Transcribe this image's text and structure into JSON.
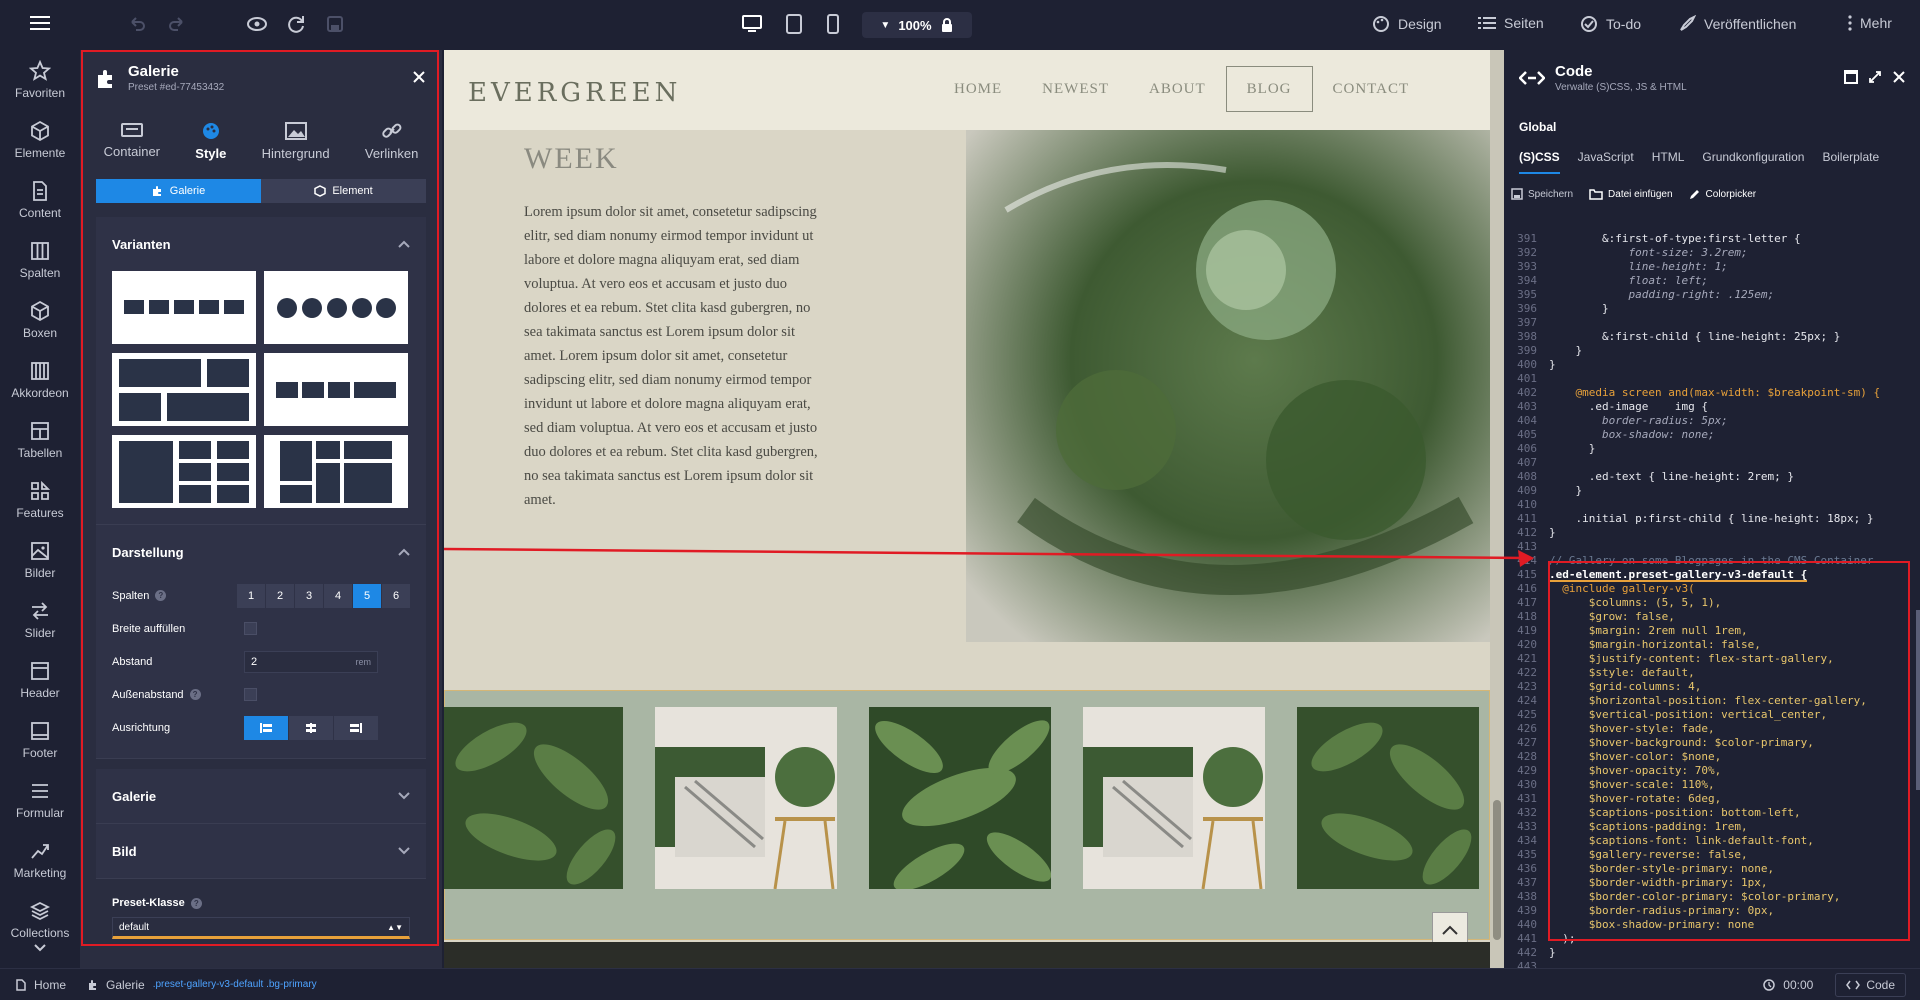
{
  "topbar": {
    "zoom": "100%",
    "design": "Design",
    "seiten": "Seiten",
    "todo": "To-do",
    "publish": "Veröffentlichen",
    "more": "Mehr"
  },
  "rail": [
    {
      "label": "Favoriten",
      "icon": "star-icon"
    },
    {
      "label": "Elemente",
      "icon": "cube-icon"
    },
    {
      "label": "Content",
      "icon": "document-icon"
    },
    {
      "label": "Spalten",
      "icon": "columns-icon"
    },
    {
      "label": "Boxen",
      "icon": "box-icon"
    },
    {
      "label": "Akkordeon",
      "icon": "accordion-icon"
    },
    {
      "label": "Tabellen",
      "icon": "table-icon"
    },
    {
      "label": "Features",
      "icon": "features-icon"
    },
    {
      "label": "Bilder",
      "icon": "image-icon"
    },
    {
      "label": "Slider",
      "icon": "slider-icon"
    },
    {
      "label": "Header",
      "icon": "header-icon"
    },
    {
      "label": "Footer",
      "icon": "footer-icon"
    },
    {
      "label": "Formular",
      "icon": "form-icon"
    },
    {
      "label": "Marketing",
      "icon": "chart-icon"
    },
    {
      "label": "Collections",
      "icon": "layers-icon"
    }
  ],
  "panel": {
    "title": "Galerie",
    "subtitle": "Preset #ed-77453432",
    "tabs": [
      "Container",
      "Style",
      "Hintergrund",
      "Verlinken"
    ],
    "seg": [
      "Galerie",
      "Element"
    ],
    "varianten": "Varianten",
    "darstellung": "Darstellung",
    "spalten_label": "Spalten",
    "spalten": [
      "1",
      "2",
      "3",
      "4",
      "5",
      "6"
    ],
    "spalten_selected": 5,
    "breite": "Breite auffüllen",
    "abstand": "Abstand",
    "abstand_value": "2",
    "abstand_unit": "rem",
    "aussenabstand": "Außenabstand",
    "ausrichtung": "Ausrichtung",
    "galerie": "Galerie",
    "bild": "Bild",
    "preset_klasse": "Preset-Klasse",
    "preset_value": "default"
  },
  "site": {
    "logo": "EVERGREEN",
    "nav": [
      "HOME",
      "NEWEST",
      "ABOUT",
      "BLOG",
      "CONTACT"
    ],
    "nav_active": "BLOG",
    "heading": "WEEK",
    "body": "Lorem ipsum dolor sit amet, consetetur sadipscing elitr, sed diam nonumy eirmod tempor invidunt ut labore et dolore magna aliquyam erat, sed diam voluptua. At vero eos et accusam et justo duo dolores et ea rebum. Stet clita kasd gubergren, no sea takimata sanctus est Lorem ipsum dolor sit amet. Lorem ipsum dolor sit amet, consetetur sadipscing elitr, sed diam nonumy eirmod tempor invidunt ut labore et dolore magna aliquyam erat, sed diam voluptua. At vero eos et accusam et justo duo dolores et ea rebum. Stet clita kasd gubergren, no sea takimata sanctus est Lorem ipsum dolor sit amet."
  },
  "code": {
    "title": "Code",
    "subtitle": "Verwalte (S)CSS, JS & HTML",
    "global": "Global",
    "tabs": [
      "(S)CSS",
      "JavaScript",
      "HTML",
      "Grundkonfiguration",
      "Boilerplate"
    ],
    "actions": [
      "Speichern",
      "Datei einfügen",
      "Colorpicker"
    ],
    "lines": [
      {
        "n": "391",
        "t": "        &:first-of-type:first-letter {",
        "c": "tx"
      },
      {
        "n": "392",
        "t": "            font-size: 3.2rem;",
        "c": "prop"
      },
      {
        "n": "393",
        "t": "            line-height: 1;",
        "c": "prop"
      },
      {
        "n": "394",
        "t": "            float: left;",
        "c": "prop"
      },
      {
        "n": "395",
        "t": "            padding-right: .125em;",
        "c": "prop"
      },
      {
        "n": "396",
        "t": "        }",
        "c": "tx"
      },
      {
        "n": "397",
        "t": "",
        "c": "tx"
      },
      {
        "n": "398",
        "t": "        &:first-child { line-height: 25px; }",
        "c": "tx"
      },
      {
        "n": "399",
        "t": "    }",
        "c": "tx"
      },
      {
        "n": "400",
        "t": "}",
        "c": "tx"
      },
      {
        "n": "401",
        "t": "",
        "c": "tx"
      },
      {
        "n": "402",
        "t": "    @media screen and(max-width: $breakpoint-sm) {",
        "c": "media"
      },
      {
        "n": "403",
        "t": "      .ed-image    img {",
        "c": "tx"
      },
      {
        "n": "404",
        "t": "        border-radius: 5px;",
        "c": "prop"
      },
      {
        "n": "405",
        "t": "        box-shadow: none;",
        "c": "prop"
      },
      {
        "n": "406",
        "t": "      }",
        "c": "tx"
      },
      {
        "n": "407",
        "t": "",
        "c": "tx"
      },
      {
        "n": "408",
        "t": "      .ed-text { line-height: 2rem; }",
        "c": "tx"
      },
      {
        "n": "409",
        "t": "    }",
        "c": "tx"
      },
      {
        "n": "410",
        "t": "",
        "c": "tx"
      },
      {
        "n": "411",
        "t": "    .initial p:first-child { line-height: 18px; }",
        "c": "tx"
      },
      {
        "n": "412",
        "t": "}",
        "c": "tx"
      },
      {
        "n": "413",
        "t": "",
        "c": "tx"
      },
      {
        "n": "414",
        "t": "// Gallery on some Blogpages in the CMS Container",
        "c": "cm"
      },
      {
        "n": "415",
        "t": ".ed-element.preset-gallery-v3-default {",
        "c": "sel"
      },
      {
        "n": "416",
        "t": "  @include gallery-v3(",
        "c": "inc"
      },
      {
        "n": "417",
        "t": "      $columns: (5, 5, 1),",
        "c": "var"
      },
      {
        "n": "418",
        "t": "      $grow: false,",
        "c": "var"
      },
      {
        "n": "419",
        "t": "      $margin: 2rem null 1rem,",
        "c": "var"
      },
      {
        "n": "420",
        "t": "      $margin-horizontal: false,",
        "c": "var"
      },
      {
        "n": "421",
        "t": "      $justify-content: flex-start-gallery,",
        "c": "var"
      },
      {
        "n": "422",
        "t": "      $style: default,",
        "c": "var"
      },
      {
        "n": "423",
        "t": "      $grid-columns: 4,",
        "c": "var"
      },
      {
        "n": "424",
        "t": "      $horizontal-position: flex-center-gallery,",
        "c": "var"
      },
      {
        "n": "425",
        "t": "      $vertical-position: vertical_center,",
        "c": "var"
      },
      {
        "n": "426",
        "t": "      $hover-style: fade,",
        "c": "var"
      },
      {
        "n": "427",
        "t": "      $hover-background: $color-primary,",
        "c": "var"
      },
      {
        "n": "428",
        "t": "      $hover-color: $none,",
        "c": "var"
      },
      {
        "n": "429",
        "t": "      $hover-opacity: 70%,",
        "c": "var"
      },
      {
        "n": "430",
        "t": "      $hover-scale: 110%,",
        "c": "var"
      },
      {
        "n": "431",
        "t": "      $hover-rotate: 6deg,",
        "c": "var"
      },
      {
        "n": "432",
        "t": "      $captions-position: bottom-left,",
        "c": "var"
      },
      {
        "n": "433",
        "t": "      $captions-padding: 1rem,",
        "c": "var"
      },
      {
        "n": "434",
        "t": "      $captions-font: link-default-font,",
        "c": "var"
      },
      {
        "n": "435",
        "t": "      $gallery-reverse: false,",
        "c": "var"
      },
      {
        "n": "436",
        "t": "      $border-style-primary: none,",
        "c": "var"
      },
      {
        "n": "437",
        "t": "      $border-width-primary: 1px,",
        "c": "var"
      },
      {
        "n": "438",
        "t": "      $border-color-primary: $color-primary,",
        "c": "var"
      },
      {
        "n": "439",
        "t": "      $border-radius-primary: 0px,",
        "c": "var"
      },
      {
        "n": "440",
        "t": "      $box-shadow-primary: none",
        "c": "var"
      },
      {
        "n": "441",
        "t": "  );",
        "c": "tx"
      },
      {
        "n": "442",
        "t": "}",
        "c": "tx"
      },
      {
        "n": "443",
        "t": "",
        "c": "tx"
      }
    ]
  },
  "status": {
    "home": "Home",
    "crumb": "Galerie",
    "classes": ".preset-gallery-v3-default .bg-primary",
    "time": "00:00",
    "code": "Code"
  },
  "colors": {
    "accent": "#1e88e5",
    "highlight": "#e01b24",
    "orange": "#e8a13a"
  }
}
